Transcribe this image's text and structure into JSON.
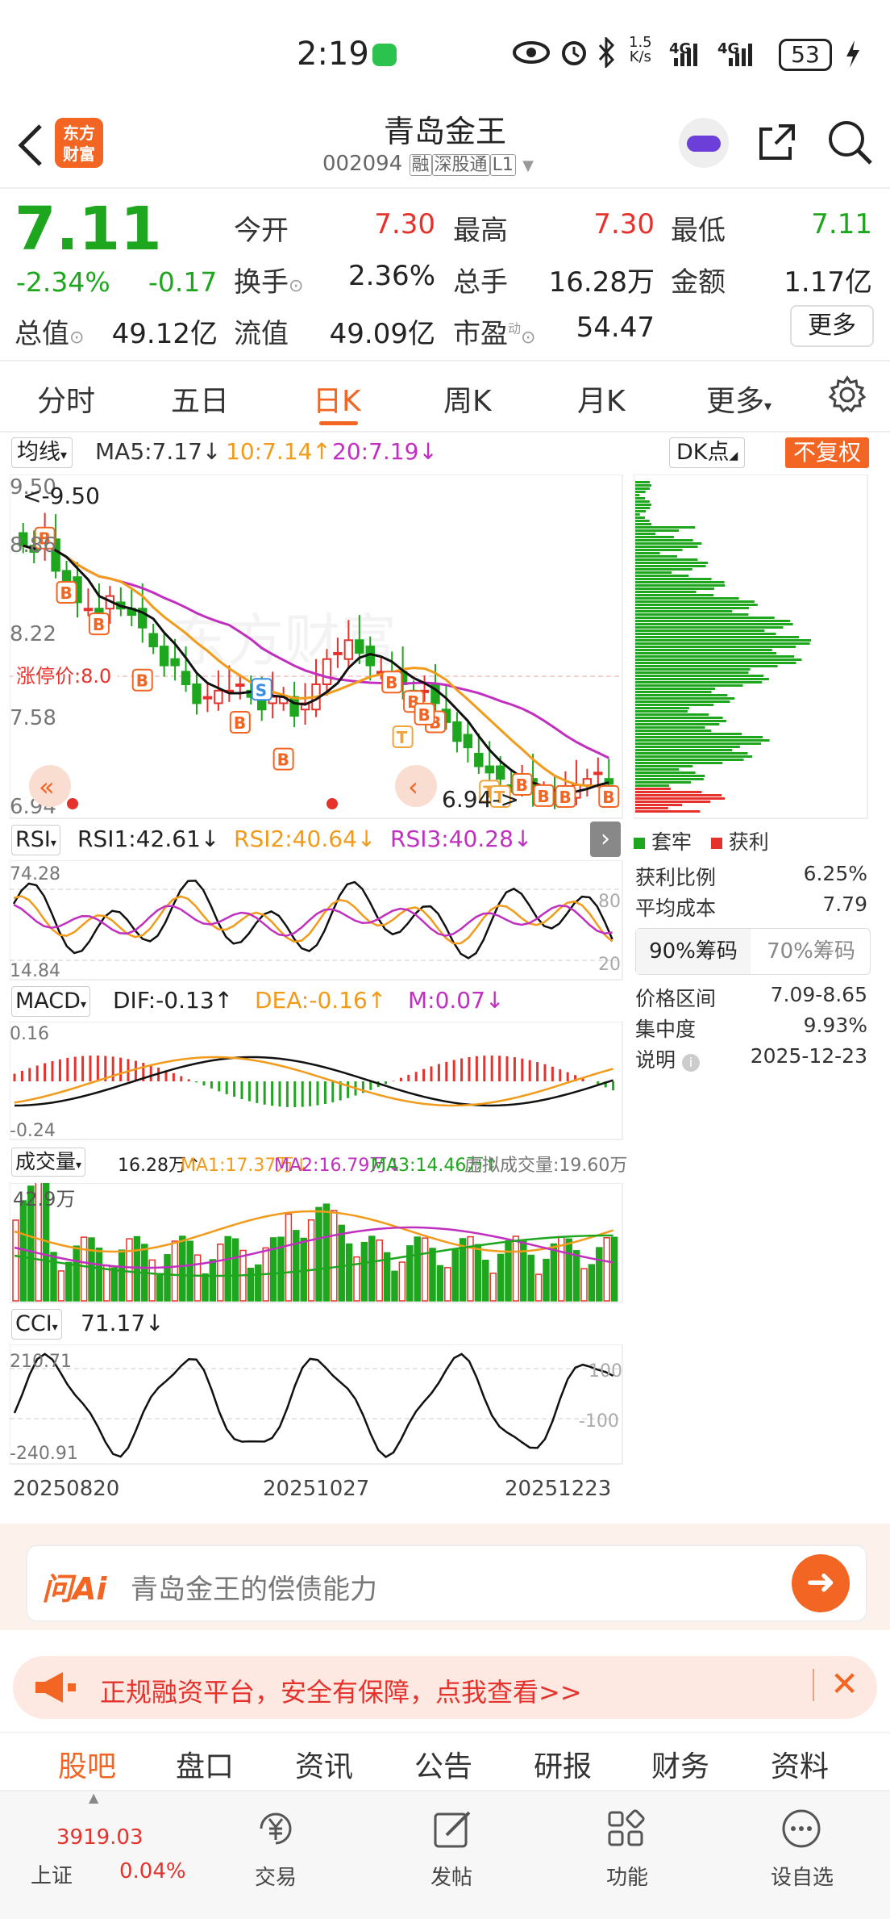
{
  "status_bar": {
    "time": "2:19",
    "net_speed_top": "1.5",
    "net_speed_bottom": "K/s",
    "signal1": "4G",
    "signal2": "4G",
    "battery": "53"
  },
  "header": {
    "title": "青岛金王",
    "code": "002094",
    "tag1": "融",
    "tag2": "深股通",
    "tag3": "L1",
    "logo_line1": "东方",
    "logo_line2": "财富"
  },
  "quote": {
    "price": "7.11",
    "change_pct": "-2.34%",
    "change": "-0.17",
    "open_label": "今开",
    "open": "7.30",
    "high_label": "最高",
    "high": "7.30",
    "low_label": "最低",
    "low": "7.11",
    "turnover_label": "换手",
    "turnover": "2.36%",
    "volume_label": "总手",
    "volume": "16.28万",
    "amount_label": "金额",
    "amount": "1.17亿",
    "mktcap_label": "总值",
    "mktcap": "49.12亿",
    "float_label": "流值",
    "float_cap": "49.09亿",
    "pe_label": "市盈",
    "pe_sup": "动",
    "pe": "54.47",
    "more_button": "更多"
  },
  "tabs": [
    "分时",
    "五日",
    "日K",
    "周K",
    "月K",
    "更多"
  ],
  "active_tab": "日K",
  "ma_bar": {
    "selector": "均线",
    "ma5": "MA5:7.17",
    "ma10": "10:7.14",
    "ma20": "20:7.19",
    "dk": "DK点",
    "fq": "不复权"
  },
  "kline": {
    "y_labels": [
      "9.50",
      "8.86",
      "8.22",
      "7.58",
      "6.94"
    ],
    "max_tag": "<-9.50",
    "min_tag": "6.94->",
    "limit_tag": "涨停价:8.0",
    "markers": [
      "B",
      "B",
      "B",
      "S",
      "B",
      "B",
      "B",
      "B",
      "B",
      "B",
      "T",
      "B",
      "T",
      "T",
      "B",
      "B",
      "B",
      "B"
    ],
    "prices": [
      9.0,
      8.95,
      9.1,
      8.8,
      8.7,
      8.55,
      8.5,
      8.45,
      8.6,
      8.5,
      8.45,
      8.35,
      8.2,
      8.05,
      8.05,
      7.9,
      7.75,
      7.8,
      7.85,
      7.85,
      7.9,
      7.8,
      7.7,
      7.8,
      7.8,
      7.65,
      7.75,
      7.9,
      8.1,
      8.15,
      8.25,
      8.15,
      8.05,
      8.0,
      7.95,
      7.9,
      7.85,
      7.85,
      7.75,
      7.6,
      7.45,
      7.4,
      7.25,
      7.2,
      7.15,
      7.1,
      7.1,
      7.05,
      7.05,
      7.0,
      7.05,
      7.1,
      7.15,
      7.2,
      7.11
    ]
  },
  "chip": {
    "legend_trapped": "套牢",
    "legend_profit": "获利",
    "profit_ratio_label": "获利比例",
    "profit_ratio": "6.25%",
    "avg_cost_label": "平均成本",
    "avg_cost": "7.79",
    "tab90": "90%筹码",
    "tab70": "70%筹码",
    "range_label": "价格区间",
    "range": "7.09-8.65",
    "concentration_label": "集中度",
    "concentration": "9.93%",
    "note_label": "说明",
    "date": "2025-12-23"
  },
  "rsi": {
    "selector": "RSI",
    "rsi1": "RSI1:42.61",
    "rsi2": "RSI2:40.64",
    "rsi3": "RSI3:40.28",
    "top": "74.28",
    "bottom": "14.84",
    "line80": "80",
    "line20": "20"
  },
  "macd": {
    "selector": "MACD",
    "dif": "DIF:-0.13",
    "dea": "DEA:-0.16",
    "m": "M:0.07",
    "top": "0.16",
    "bottom": "-0.24"
  },
  "volume": {
    "selector": "成交量",
    "vol": "16.28万",
    "ma1": "MA1:17.37万",
    "ma2": "MA2:16.79万",
    "ma3": "MA3:14.46万",
    "virtual": "虚拟成交量:19.60万",
    "top": "42.9万"
  },
  "cci": {
    "selector": "CCI",
    "value": "71.17",
    "top": "210.71",
    "bottom": "-240.91",
    "line100": "100",
    "linem100": "-100"
  },
  "dates": [
    "20250820",
    "20251027",
    "20251223"
  ],
  "ai_box": {
    "brand": "问Ai",
    "placeholder": "青岛金王的偿债能力"
  },
  "ad_banner": {
    "text": "正规融资平台，安全有保障，点我查看>>"
  },
  "bottom_tabs": [
    "股吧",
    "盘口",
    "资讯",
    "公告",
    "研报",
    "财务",
    "资料"
  ],
  "index": {
    "value": "3919.03",
    "name": "上证",
    "pct": "0.04%"
  },
  "bottom_nav": [
    "交易",
    "发帖",
    "功能",
    "设自选"
  ],
  "colors": {
    "up": "#e5322d",
    "down": "#1ea61e",
    "accent": "#f26522",
    "ma10": "#f29b1a",
    "ma20": "#c02fbf"
  }
}
